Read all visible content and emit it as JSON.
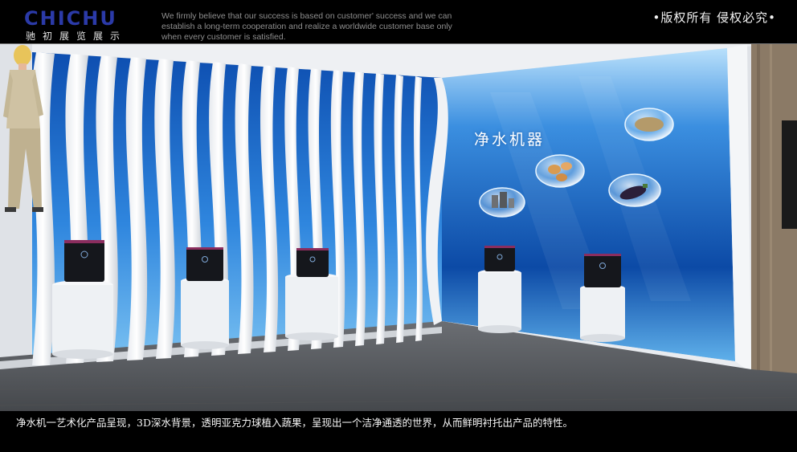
{
  "header": {
    "logo_text": "CHICHU",
    "logo_subtitle": "驰初展览展示",
    "slogan": "We firmly believe that our success is based on customer' success and we can establish a long-term cooperation and realize a worldwide customer base only when every customer is satisfied.",
    "copyright": "•版权所有  侵权必究•"
  },
  "scene": {
    "wall_title": "净水机器",
    "colors": {
      "water_deep": "#0a3f9a",
      "water_light": "#3f95e6",
      "panel_white": "#f4f6f8",
      "floor": "#5b5e63"
    },
    "bubble_icons": [
      "grain-icon",
      "egg-icon",
      "building-icon",
      "eggplant-icon"
    ]
  },
  "caption": {
    "text": "净水机一艺术化产品呈现，3D深水背景，透明亚克力球植入蔬果，呈现出一个洁净通透的世界，从而鲜明衬托出产品的特性。"
  }
}
